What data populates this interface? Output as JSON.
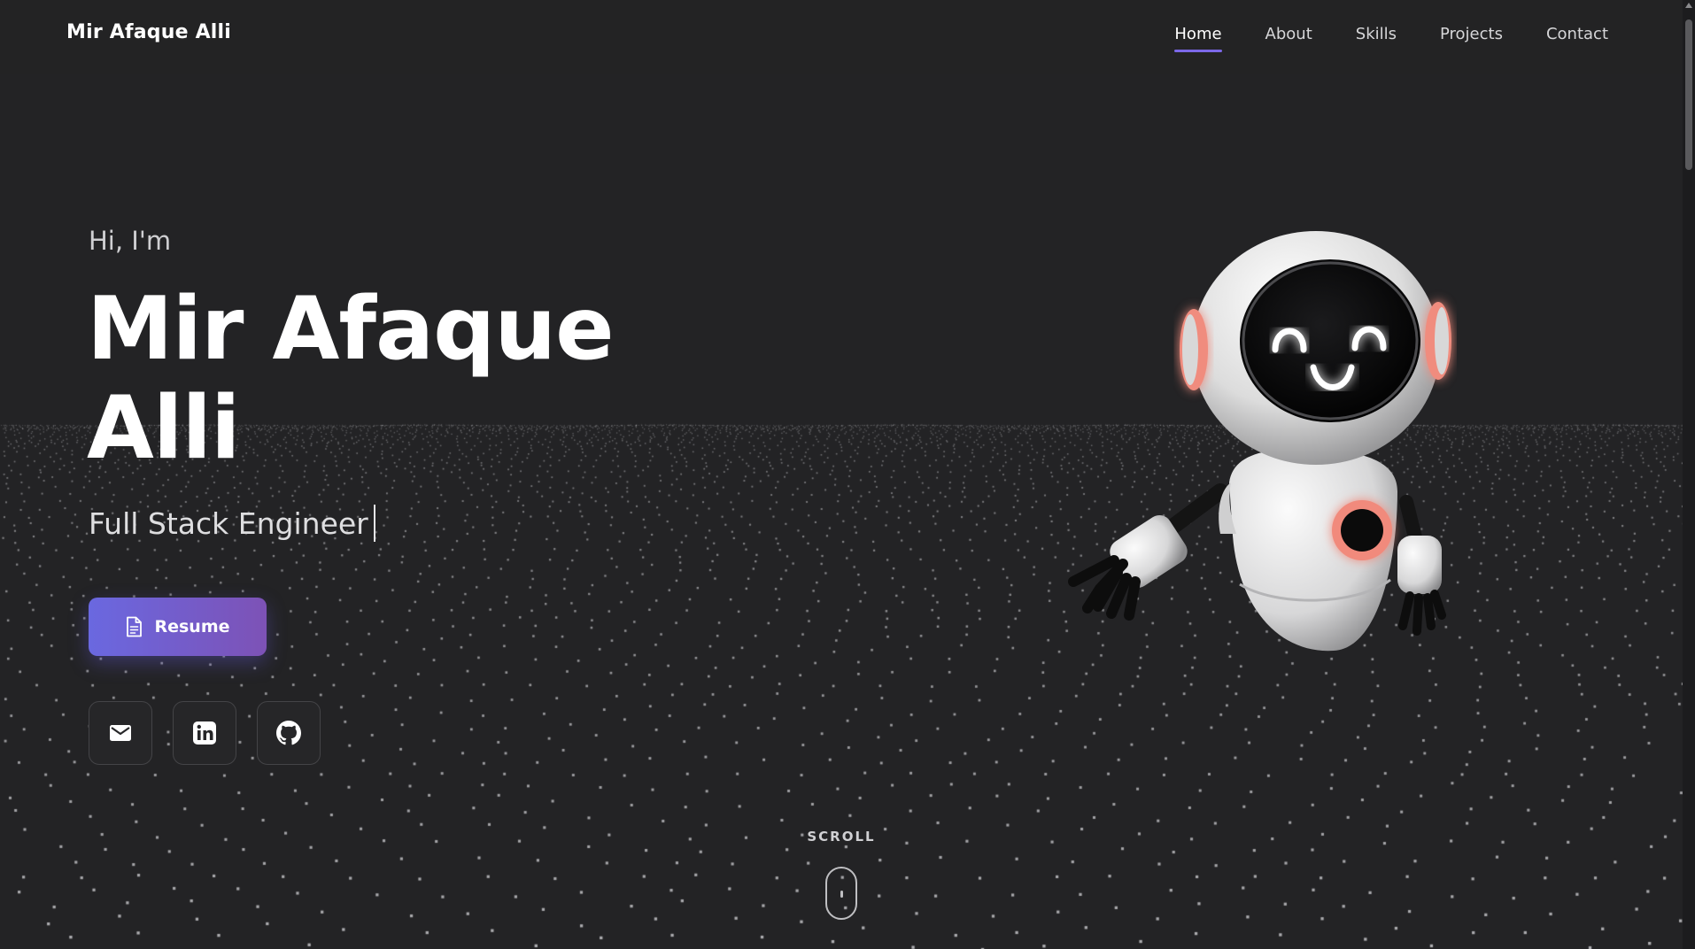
{
  "header": {
    "brand": "Mir Afaque Alli",
    "nav": [
      "Home",
      "About",
      "Skills",
      "Projects",
      "Contact"
    ],
    "active": "Home"
  },
  "hero": {
    "greeting": "Hi, I'm",
    "name_line1": "Mir Afaque",
    "name_line2": "Alli",
    "role": "Full Stack Engineer",
    "resume_label": "Resume"
  },
  "social": {
    "icons": [
      "mail-icon",
      "linkedin-icon",
      "github-icon"
    ]
  },
  "scroll": {
    "label": "SCROLL"
  },
  "colors": {
    "background": "#232325",
    "accent": "#7b68e8",
    "button_start": "#6a68e0",
    "button_end": "#7d52b6",
    "robot_accent": "#f08c7e"
  }
}
